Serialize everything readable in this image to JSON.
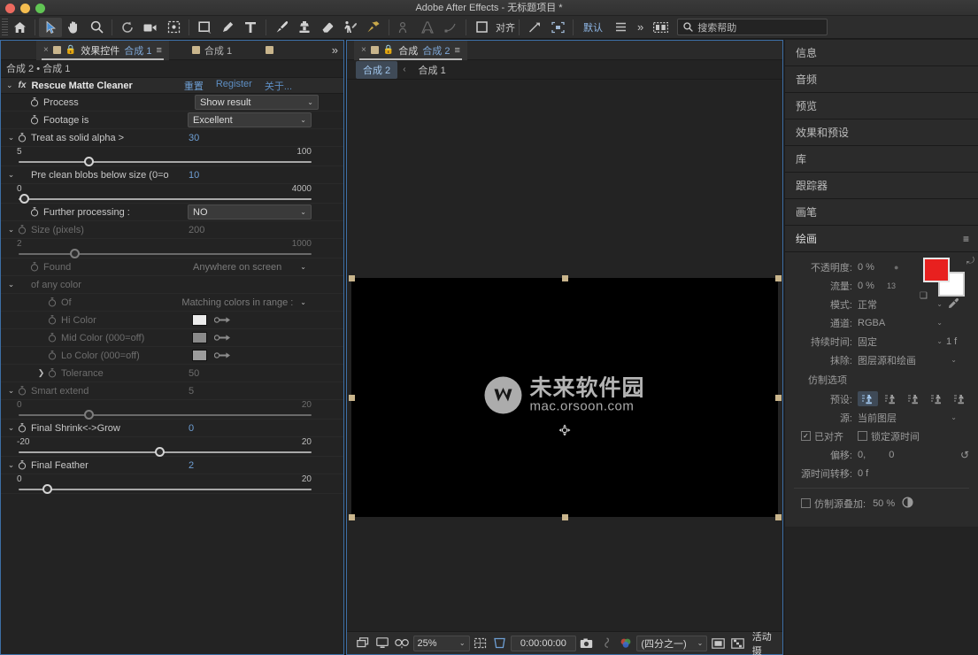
{
  "window": {
    "title": "Adobe After Effects - 无标题项目 *"
  },
  "toolbar": {
    "icons": [
      {
        "name": "home-icon",
        "label": "Home"
      },
      {
        "name": "selection-tool",
        "label": "Selection"
      },
      {
        "name": "hand-tool",
        "label": "Hand"
      },
      {
        "name": "zoom-tool",
        "label": "Zoom"
      },
      {
        "name": "rotation-tool",
        "label": "Rotation"
      },
      {
        "name": "camera-tool",
        "label": "Camera"
      },
      {
        "name": "pan-behind-tool",
        "label": "Pan Behind"
      },
      {
        "name": "shape-tool",
        "label": "Shape"
      },
      {
        "name": "pen-tool",
        "label": "Pen"
      },
      {
        "name": "text-tool",
        "label": "Text"
      },
      {
        "name": "brush-tool",
        "label": "Brush"
      },
      {
        "name": "clone-stamp-tool",
        "label": "Clone Stamp"
      },
      {
        "name": "eraser-tool",
        "label": "Eraser"
      },
      {
        "name": "roto-brush-tool",
        "label": "Roto Brush"
      },
      {
        "name": "puppet-pin-tool",
        "label": "Puppet Pin"
      }
    ],
    "align_label": "对齐",
    "workspace_label": "默认",
    "search_placeholder": "搜索帮助"
  },
  "effects_panel": {
    "tabs": [
      {
        "label_main": "效果控件",
        "label_accent": "合成 1",
        "active": true
      },
      {
        "label_main": "合成 1",
        "label_accent": "",
        "active": false
      }
    ],
    "breadcrumb": "合成 2 • 合成 1",
    "effect_name": "Rescue Matte Cleaner",
    "links": {
      "reset": "重置",
      "register": "Register",
      "about": "关于..."
    },
    "properties": [
      {
        "name": "Process",
        "type": "dropdown",
        "value": "Show result",
        "dimmed": false,
        "indent": 1,
        "twirl": false,
        "stopwatch": true
      },
      {
        "name": "Footage is",
        "type": "dropdown",
        "value": "Excellent",
        "dimmed": false,
        "indent": 1,
        "twirl": false,
        "stopwatch": true
      },
      {
        "name": "Treat as solid alpha >",
        "type": "slider",
        "value": "30",
        "min": "5",
        "max": "100",
        "knob_pct": 25,
        "dimmed": false,
        "indent": 0,
        "twirl": true,
        "stopwatch": true
      },
      {
        "name": "Pre clean blobs below size (0=o",
        "type": "slider",
        "value": "10",
        "min": "0",
        "max": "4000",
        "knob_pct": 2,
        "dimmed": false,
        "indent": 0,
        "twirl": true,
        "stopwatch": false
      },
      {
        "name": "Further processing :",
        "type": "dropdown",
        "value": "NO",
        "dimmed": false,
        "indent": 1,
        "twirl": false,
        "stopwatch": true
      },
      {
        "name": "Size (pixels)",
        "type": "slider",
        "value": "200",
        "min": "2",
        "max": "1000",
        "knob_pct": 20,
        "dimmed": true,
        "indent": 0,
        "twirl": true,
        "stopwatch": true
      },
      {
        "name": "Found",
        "type": "dropdown",
        "value": "Anywhere on screen",
        "dimmed": true,
        "indent": 1,
        "twirl": false,
        "stopwatch": true
      },
      {
        "name": "of any color",
        "type": "group",
        "value": "",
        "dimmed": true,
        "indent": 0,
        "twirl": true,
        "stopwatch": false
      },
      {
        "name": "Of",
        "type": "dropdown",
        "value": "Matching colors in range :",
        "dimmed": true,
        "indent": 2,
        "twirl": false,
        "stopwatch": true
      },
      {
        "name": "Hi Color",
        "type": "color",
        "swatch": "#ebebeb",
        "dimmed": true,
        "indent": 2,
        "twirl": false,
        "stopwatch": true
      },
      {
        "name": "Mid Color (000=off)",
        "type": "color",
        "swatch": "#8a8a8a",
        "dimmed": true,
        "indent": 2,
        "twirl": false,
        "stopwatch": true
      },
      {
        "name": "Lo Color (000=off)",
        "type": "color",
        "swatch": "#9c9c9c",
        "dimmed": true,
        "indent": 2,
        "twirl": false,
        "stopwatch": true
      },
      {
        "name": "Tolerance",
        "type": "value",
        "value": "50",
        "dimmed": true,
        "indent": 2,
        "twirl": "right",
        "stopwatch": true
      },
      {
        "name": "Smart extend",
        "type": "slider",
        "value": "5",
        "min": "0",
        "max": "20",
        "knob_pct": 25,
        "dimmed": true,
        "indent": 0,
        "twirl": true,
        "stopwatch": true
      },
      {
        "name": "Final Shrink<->Grow",
        "type": "slider",
        "value": "0",
        "min": "-20",
        "max": "20",
        "knob_pct": 50,
        "dimmed": false,
        "indent": 0,
        "twirl": true,
        "stopwatch": true
      },
      {
        "name": "Final Feather",
        "type": "slider",
        "value": "2",
        "min": "0",
        "max": "20",
        "knob_pct": 10,
        "dimmed": false,
        "indent": 0,
        "twirl": true,
        "stopwatch": true
      }
    ]
  },
  "comp_panel": {
    "tabs": [
      {
        "label_main": "合成",
        "label_accent": "合成 2",
        "active": true
      }
    ],
    "subtabs": [
      {
        "label": "合成 2",
        "active": true
      },
      {
        "label": "合成 1",
        "active": false
      }
    ],
    "watermark": {
      "cn": "未来软件园",
      "en": "mac.orsoon.com"
    },
    "toolbar": {
      "zoom": "25%",
      "timecode": "0:00:00:00",
      "resolution": "(四分之一)",
      "active_camera": "活动摄"
    }
  },
  "sidebar": {
    "items": [
      {
        "label": "信息",
        "active": false
      },
      {
        "label": "音频",
        "active": false
      },
      {
        "label": "预览",
        "active": false
      },
      {
        "label": "效果和预设",
        "active": false
      },
      {
        "label": "库",
        "active": false
      },
      {
        "label": "跟踪器",
        "active": false
      },
      {
        "label": "画笔",
        "active": false
      },
      {
        "label": "绘画",
        "active": true
      }
    ],
    "paint": {
      "opacity_label": "不透明度:",
      "opacity_value": "0 %",
      "flow_label": "流量:",
      "flow_value": "0 %",
      "brush_size": "13",
      "mode_label": "模式:",
      "mode_value": "正常",
      "channel_label": "通道:",
      "channel_value": "RGBA",
      "duration_label": "持续时间:",
      "duration_value": "固定",
      "duration_frames": "1 f",
      "erase_label": "抹除:",
      "erase_value": "图层源和绘画",
      "foreground_color": "#e8201f",
      "background_color": "#ffffff"
    },
    "clone": {
      "section_label": "仿制选项",
      "preset_label": "预设:",
      "presets": [
        "1",
        "2",
        "3",
        "4",
        "5"
      ],
      "active_preset": 0,
      "source_label": "源:",
      "source_value": "当前图层",
      "aligned_label": "已对齐",
      "aligned_checked": true,
      "lock_source_label": "锁定源时间",
      "lock_source_checked": false,
      "offset_label": "偏移:",
      "offset_x": "0,",
      "offset_y": "0",
      "source_time_shift_label": "源时间转移:",
      "source_time_shift_value": "0 f",
      "overlay_label": "仿制源叠加:",
      "overlay_checked": false,
      "overlay_value": "50 %"
    }
  }
}
